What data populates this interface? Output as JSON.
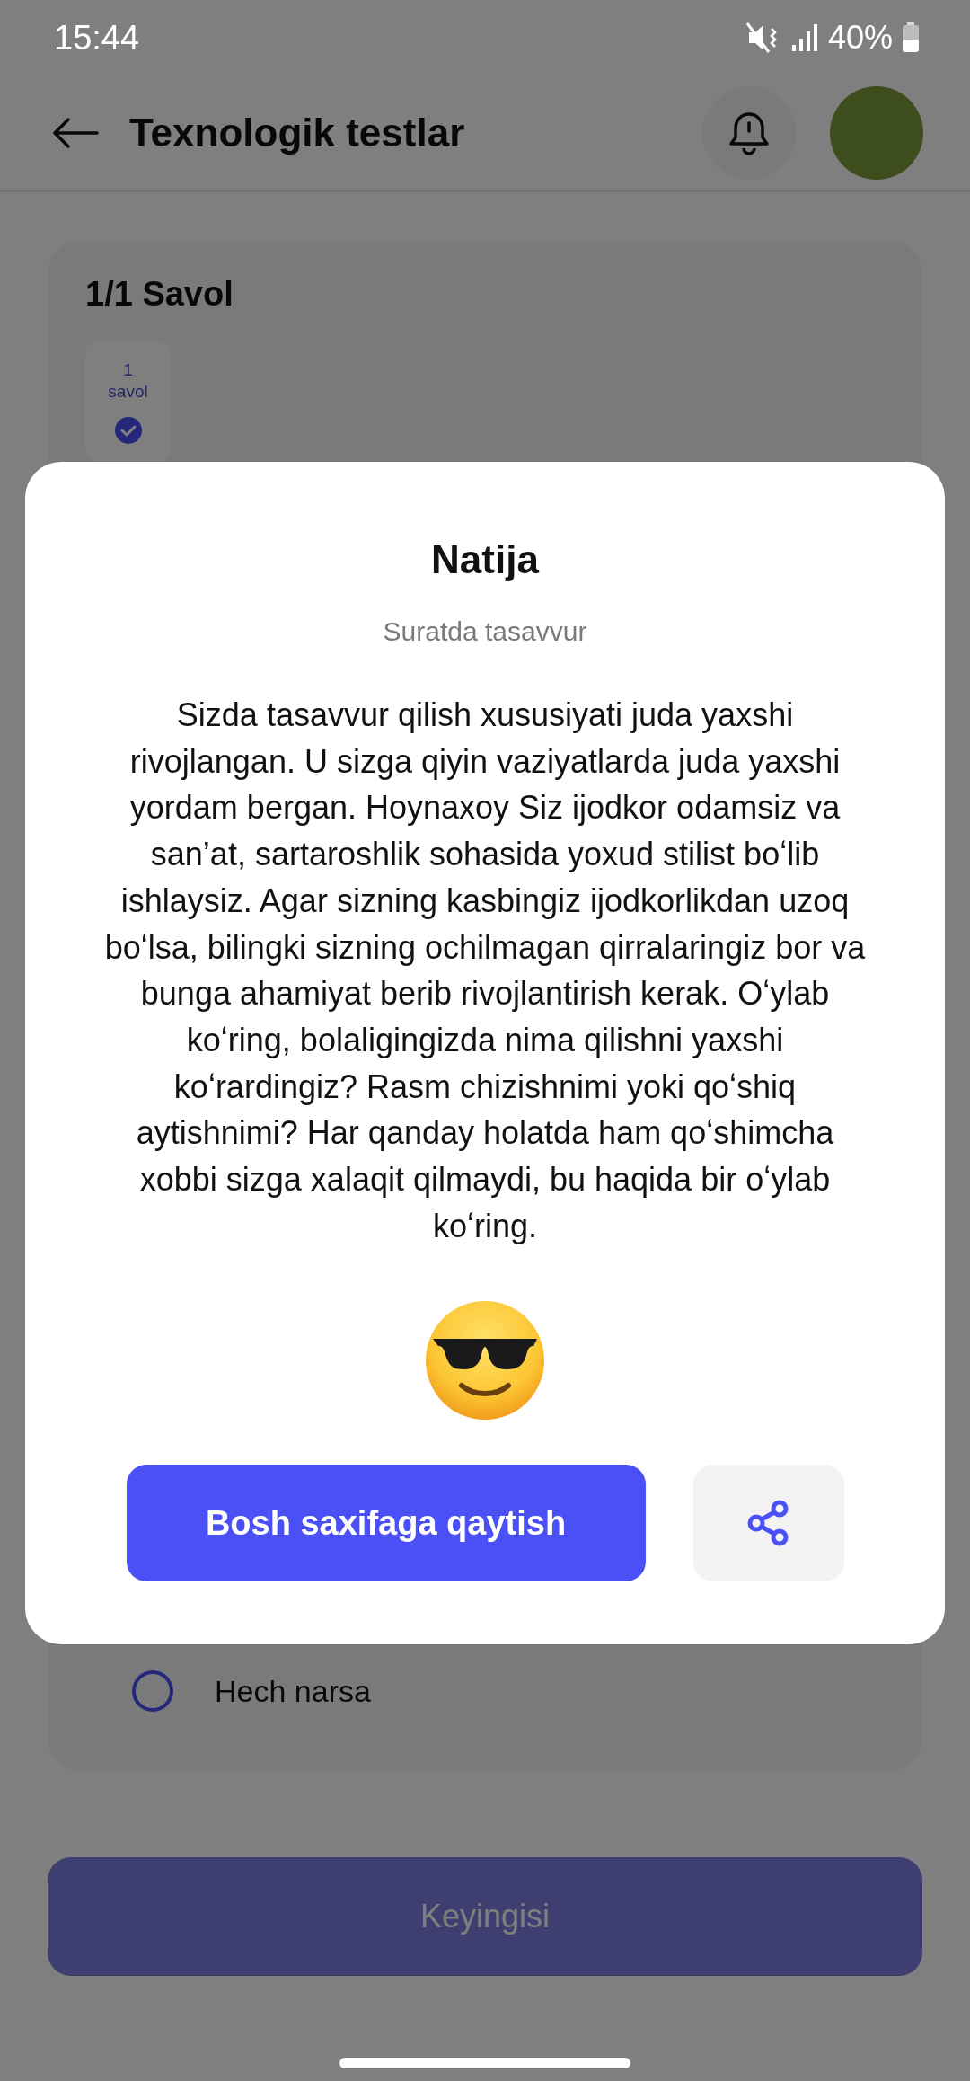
{
  "status_bar": {
    "time": "15:44",
    "battery": "40%"
  },
  "header": {
    "title": "Texnologik testlar"
  },
  "question_card": {
    "counter": "1/1 Savol",
    "questions": [
      {
        "number": "1",
        "label": "savol",
        "answered": true
      }
    ],
    "options": [
      {
        "label": "Hech narsa",
        "selected": false
      }
    ]
  },
  "next_button": {
    "label": "Keyingisi",
    "disabled": true
  },
  "result_dialog": {
    "title": "Natija",
    "subtitle": "Suratda tasavvur",
    "description": "Sizda tasavvur qilish xususiyati juda yaxshi rivojlangan. U sizga qiyin vaziyatlarda juda yaxshi yordam bergan. Hoynaxoy Siz ijodkor odamsiz va san’at, sartaroshlik sohasida yoxud stilist boʻlib ishlaysiz. Agar sizning kasbingiz ijodkorlikdan uzoq boʻlsa, bilingki sizning ochilmagan qirralaringiz bor va bunga ahamiyat berib rivojlantirish kerak. Oʻylab koʻring, bolaligingizda nima qilishni yaxshi koʻrardingiz? Rasm chizishnimi yoki qoʻshiq aytishnimi? Har qanday holatda ham qoʻshimcha xobbi sizga xalaqit qilmaydi, bu haqida bir oʻylab koʻring.",
    "primary_button": "Bosh saxifaga qaytish"
  }
}
